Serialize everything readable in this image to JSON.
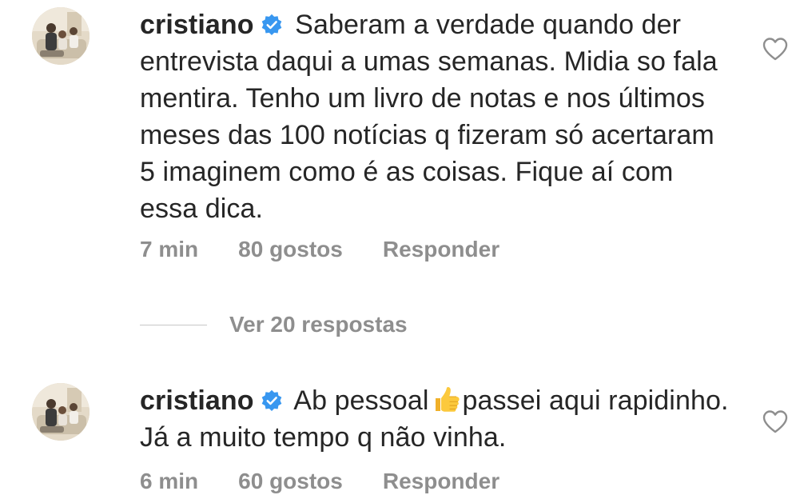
{
  "comments": [
    {
      "username": "cristiano",
      "text": "Saberam a verdade quando der entrevista daqui a umas semanas. Midia so fala mentira. Tenho um livro de notas e nos últimos meses das  100 notícias q fizeram só acertaram 5 imaginem como é as coisas. Fique aí com essa dica.",
      "time": "7 min",
      "likes": "80 gostos",
      "reply": "Responder"
    },
    {
      "username": "cristiano",
      "text_before_emoji": "Ab pessoal",
      "emoji": "thumbs-up-icon",
      "text_after_emoji": "passei aqui rapidinho. Já a muito tempo q não vinha.",
      "time": "6 min",
      "likes": "60 gostos",
      "reply": "Responder"
    }
  ],
  "view_replies_label": "Ver 20 respostas",
  "colors": {
    "text": "#262626",
    "secondary": "#8e8e8e",
    "verified": "#3897f0"
  }
}
